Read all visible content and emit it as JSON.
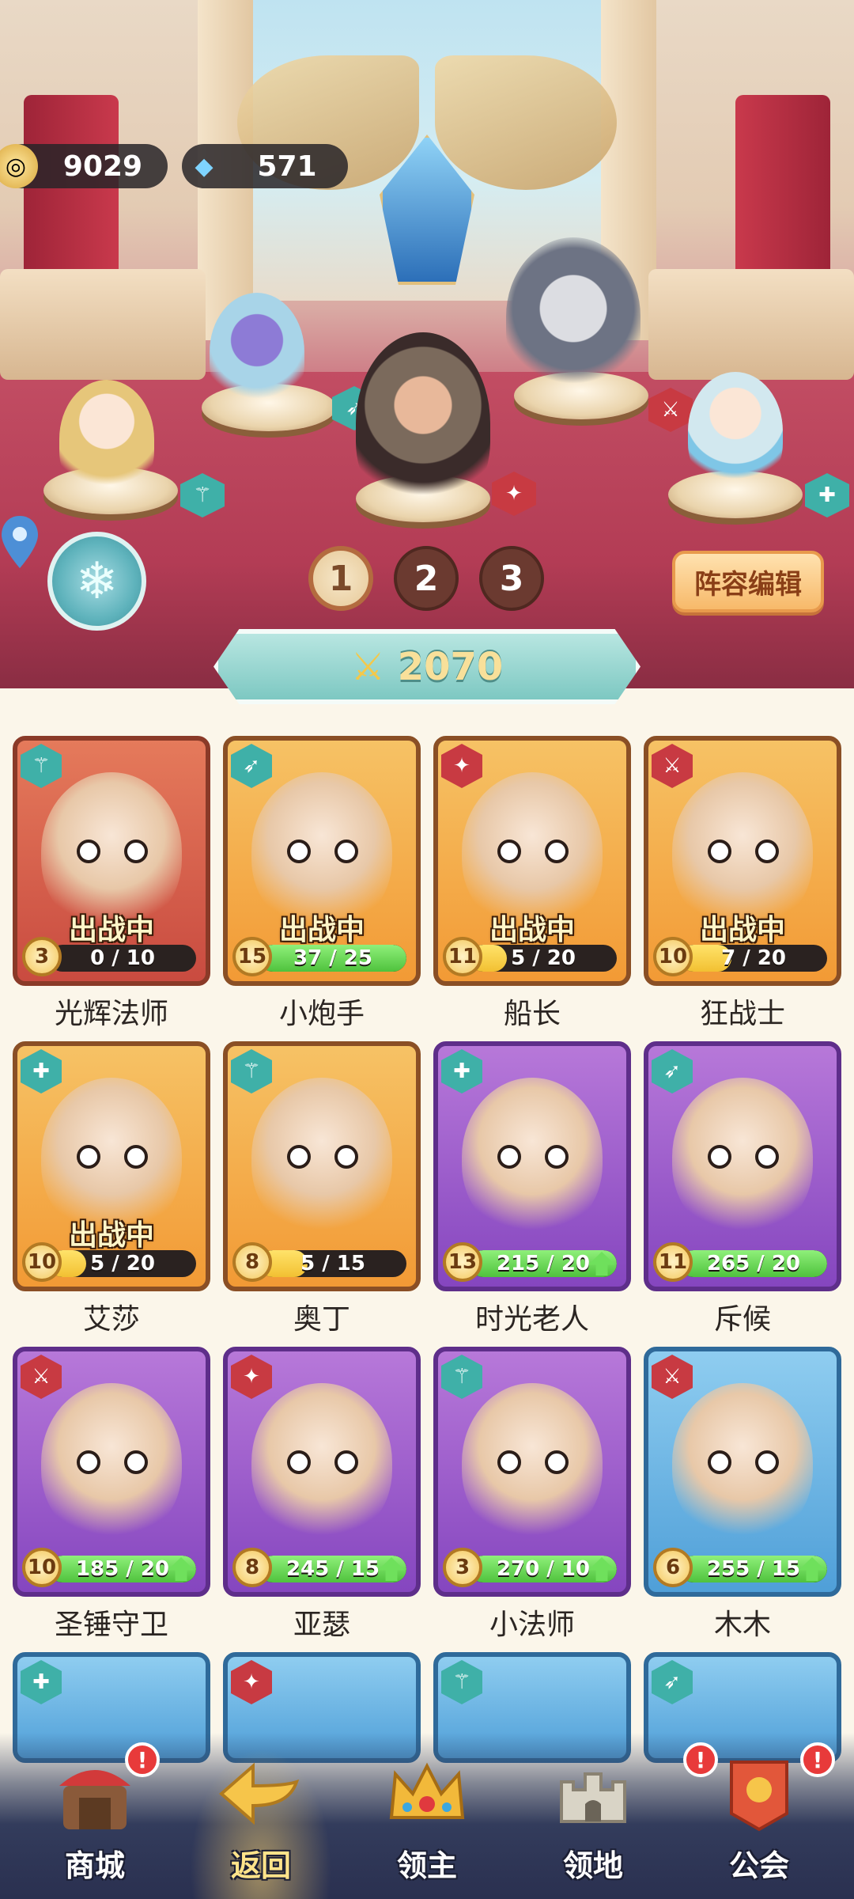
{
  "currency": {
    "gold": "9029",
    "gems": "571"
  },
  "formation": {
    "pages": [
      "1",
      "2",
      "3"
    ],
    "active_page": "1",
    "edit_label": "阵容编辑"
  },
  "power": {
    "value": "2070"
  },
  "heroes": [
    {
      "name": "光辉法师",
      "level": "3",
      "progress": "0 / 10",
      "fraction": 0.0,
      "deployed": true,
      "deploy_label": "出战中",
      "class": "staff",
      "color": "red",
      "upgradable": false
    },
    {
      "name": "小炮手",
      "level": "15",
      "progress": "37 / 25",
      "fraction": 1.0,
      "deployed": true,
      "deploy_label": "出战中",
      "class": "bow",
      "color": "orange",
      "upgradable": false
    },
    {
      "name": "船长",
      "level": "11",
      "progress": "5 / 20",
      "fraction": 0.25,
      "deployed": true,
      "deploy_label": "出战中",
      "class": "assassin",
      "color": "orange",
      "upgradable": false
    },
    {
      "name": "狂战士",
      "level": "10",
      "progress": "7 / 20",
      "fraction": 0.35,
      "deployed": true,
      "deploy_label": "出战中",
      "class": "sword",
      "color": "orange",
      "upgradable": false
    },
    {
      "name": "艾莎",
      "level": "10",
      "progress": "5 / 20",
      "fraction": 0.25,
      "deployed": true,
      "deploy_label": "出战中",
      "class": "support",
      "color": "orange",
      "upgradable": false
    },
    {
      "name": "奥丁",
      "level": "8",
      "progress": "5 / 15",
      "fraction": 0.33,
      "deployed": false,
      "deploy_label": "",
      "class": "staff",
      "color": "orange",
      "upgradable": false
    },
    {
      "name": "时光老人",
      "level": "13",
      "progress": "215 / 20",
      "fraction": 1.0,
      "deployed": false,
      "deploy_label": "",
      "class": "support",
      "color": "purple",
      "upgradable": true
    },
    {
      "name": "斥候",
      "level": "11",
      "progress": "265 / 20",
      "fraction": 1.0,
      "deployed": false,
      "deploy_label": "",
      "class": "bow",
      "color": "purple",
      "upgradable": false
    },
    {
      "name": "圣锤守卫",
      "level": "10",
      "progress": "185 / 20",
      "fraction": 1.0,
      "deployed": false,
      "deploy_label": "",
      "class": "sword",
      "color": "purple",
      "upgradable": true
    },
    {
      "name": "亚瑟",
      "level": "8",
      "progress": "245 / 15",
      "fraction": 1.0,
      "deployed": false,
      "deploy_label": "",
      "class": "assassin",
      "color": "purple",
      "upgradable": true
    },
    {
      "name": "小法师",
      "level": "3",
      "progress": "270 / 10",
      "fraction": 1.0,
      "deployed": false,
      "deploy_label": "",
      "class": "staff",
      "color": "purple",
      "upgradable": true
    },
    {
      "name": "木木",
      "level": "6",
      "progress": "255 / 15",
      "fraction": 1.0,
      "deployed": false,
      "deploy_label": "",
      "class": "sword",
      "color": "blue",
      "upgradable": true
    }
  ],
  "partial_heroes": [
    {
      "class": "support",
      "color": "blue"
    },
    {
      "class": "assassin",
      "color": "blue"
    },
    {
      "class": "staff",
      "color": "blue"
    },
    {
      "class": "bow",
      "color": "blue"
    }
  ],
  "nav": [
    {
      "label": "商城",
      "icon": "shop-icon",
      "alert": true
    },
    {
      "label": "返回",
      "icon": "back-arrow-icon",
      "alert": false,
      "active": true
    },
    {
      "label": "领主",
      "icon": "crown-icon",
      "alert": false
    },
    {
      "label": "领地",
      "icon": "castle-icon",
      "alert": false
    },
    {
      "label": "公会",
      "icon": "guild-banner-icon",
      "alert": true
    }
  ],
  "colors": {
    "card_orange": "#f29a35",
    "card_red": "#c94b40",
    "card_purple": "#8546bf",
    "card_blue": "#4f9fd8",
    "power_bar": "#7dc8c2",
    "progress_green": "#4fc23d",
    "alert_red": "#e83a3a"
  }
}
